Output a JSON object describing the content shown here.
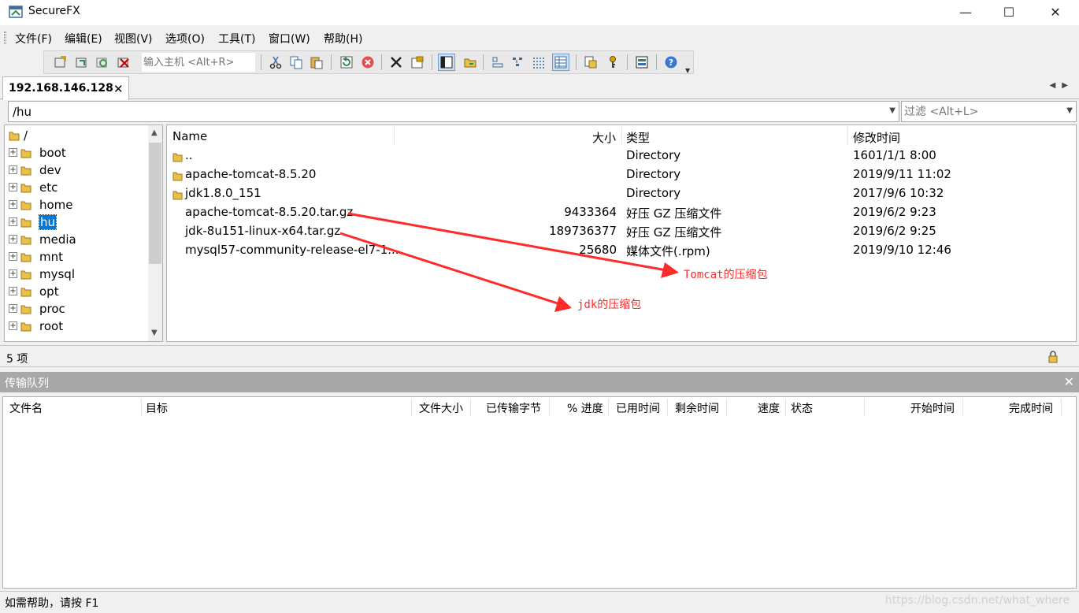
{
  "window": {
    "title": "SecureFX",
    "controls": {
      "minimize": "—",
      "maximize": "☐",
      "close": "✕"
    }
  },
  "menu": [
    "文件(F)",
    "编辑(E)",
    "视图(V)",
    "选项(O)",
    "工具(T)",
    "窗口(W)",
    "帮助(H)"
  ],
  "toolbar": {
    "host_placeholder": "输入主机 <Alt+R>"
  },
  "tab": {
    "label": "192.168.146.128",
    "close": "✕"
  },
  "path": {
    "value": "/hu",
    "filter_placeholder": "过滤 <Alt+L>"
  },
  "tree": {
    "root": "/",
    "items": [
      {
        "label": "boot"
      },
      {
        "label": "dev"
      },
      {
        "label": "etc"
      },
      {
        "label": "home"
      },
      {
        "label": "hu",
        "selected": true
      },
      {
        "label": "media"
      },
      {
        "label": "mnt"
      },
      {
        "label": "mysql"
      },
      {
        "label": "opt"
      },
      {
        "label": "proc"
      },
      {
        "label": "root"
      }
    ]
  },
  "files": {
    "columns": {
      "name": "Name",
      "size": "大小",
      "type": "类型",
      "modified": "修改时间"
    },
    "rows": [
      {
        "name": "..",
        "size": "",
        "type": "Directory",
        "modified": "1601/1/1 8:00",
        "is_dir": true
      },
      {
        "name": "apache-tomcat-8.5.20",
        "size": "",
        "type": "Directory",
        "modified": "2019/9/11 11:02",
        "is_dir": true
      },
      {
        "name": "jdk1.8.0_151",
        "size": "",
        "type": "Directory",
        "modified": "2017/9/6 10:32",
        "is_dir": true
      },
      {
        "name": "apache-tomcat-8.5.20.tar.gz",
        "size": "9433364",
        "type": "好压 GZ 压缩文件",
        "modified": "2019/6/2 9:23",
        "is_dir": false
      },
      {
        "name": "jdk-8u151-linux-x64.tar.gz",
        "size": "189736377",
        "type": "好压 GZ 压缩文件",
        "modified": "2019/6/2 9:25",
        "is_dir": false
      },
      {
        "name": "mysql57-community-release-el7-1...",
        "size": "25680",
        "type": "媒体文件(.rpm)",
        "modified": "2019/9/10 12:46",
        "is_dir": false
      }
    ]
  },
  "annotations": {
    "tomcat": "Tomcat的压缩包",
    "jdk": "jdk的压缩包",
    "color": "#ff2b2b"
  },
  "status": {
    "count": "5 项"
  },
  "queue": {
    "title": "传输队列",
    "close": "✕",
    "columns": [
      "文件名",
      "目标",
      "文件大小",
      "已传输字节",
      "% 进度",
      "已用时间",
      "剩余时间",
      "速度",
      "状态",
      "开始时间",
      "完成时间"
    ]
  },
  "footer": {
    "help": "如需帮助，请按 F1",
    "watermark": "https://blog.csdn.net/what_where"
  }
}
